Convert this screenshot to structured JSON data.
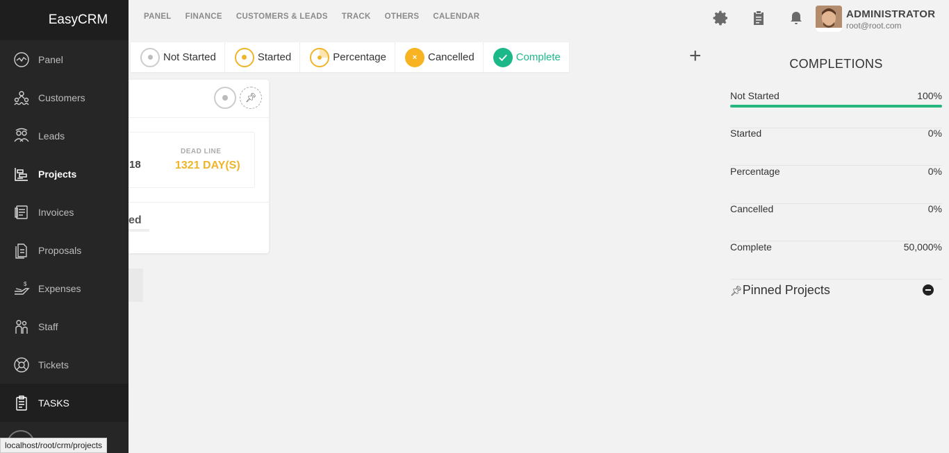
{
  "brand": "EasyCRM",
  "sidebar": {
    "items": [
      {
        "label": "Panel",
        "icon": "panel-icon"
      },
      {
        "label": "Customers",
        "icon": "customers-icon"
      },
      {
        "label": "Leads",
        "icon": "leads-icon"
      },
      {
        "label": "Projects",
        "icon": "projects-icon"
      },
      {
        "label": "Invoices",
        "icon": "invoices-icon"
      },
      {
        "label": "Proposals",
        "icon": "proposals-icon"
      },
      {
        "label": "Expenses",
        "icon": "expenses-icon"
      },
      {
        "label": "Staff",
        "icon": "staff-icon"
      },
      {
        "label": "Tickets",
        "icon": "tickets-icon"
      },
      {
        "label": "TASKS",
        "icon": "tasks-icon"
      }
    ]
  },
  "topnav": [
    "PANEL",
    "FINANCE",
    "CUSTOMERS & LEADS",
    "TRACK",
    "OTHERS",
    "CALENDAR"
  ],
  "user": {
    "name": "ADMINISTRATOR",
    "email": "root@root.com"
  },
  "filters": [
    {
      "label": "Not Started",
      "color": "#bbbbbb"
    },
    {
      "label": "Started",
      "color": "#f0b429"
    },
    {
      "label": "Percentage",
      "color": "#f0b429"
    },
    {
      "label": "Cancelled",
      "color": "#f7b322"
    },
    {
      "label": "Complete",
      "color": "#1cb88a"
    }
  ],
  "card": {
    "date_fragment": "18",
    "deadline_label": "DEAD LINE",
    "deadline_value": "1321 DAY(S)",
    "status_fragment": "ed"
  },
  "completions": {
    "title": "COMPLETIONS",
    "rows": [
      {
        "label": "Not Started",
        "value": "100%",
        "progress": 1.0
      },
      {
        "label": "Started",
        "value": "0%"
      },
      {
        "label": "Percentage",
        "value": "0%"
      },
      {
        "label": "Cancelled",
        "value": "0%"
      },
      {
        "label": "Complete",
        "value": "50,000%"
      }
    ]
  },
  "pinned": {
    "title": "Pinned Projects"
  },
  "status_url": "localhost/root/crm/projects",
  "colors": {
    "accent_green": "#26b77f",
    "deadline": "#f0b429"
  }
}
